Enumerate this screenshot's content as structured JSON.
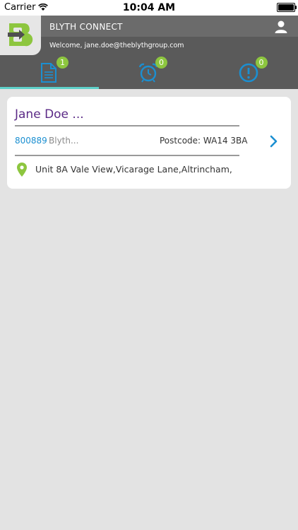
{
  "status_bar": {
    "carrier": "Carrier",
    "time": "10:04 AM"
  },
  "header": {
    "app_title": "BLYTH CONNECT",
    "welcome": "Welcome, jane.doe@theblythgroup.com",
    "logo_color": "#8dc63f"
  },
  "tabs": [
    {
      "icon": "document-icon",
      "badge": "1"
    },
    {
      "icon": "alarm-clock-icon",
      "badge": "0"
    },
    {
      "icon": "alert-icon",
      "badge": "0"
    }
  ],
  "job": {
    "customer_name": "Jane Doe ...",
    "job_number": "800889",
    "site_name": "Blyth...",
    "postcode_label": "Postcode:",
    "postcode": "WA14 3BA",
    "address": "Unit 8A Vale View,Vicarage Lane,Altrincham,"
  },
  "colors": {
    "accent_blue": "#1b8fd1",
    "badge_green": "#8dc63f",
    "name_purple": "#5b2a86",
    "tab_indicator": "#5ed0c9"
  }
}
